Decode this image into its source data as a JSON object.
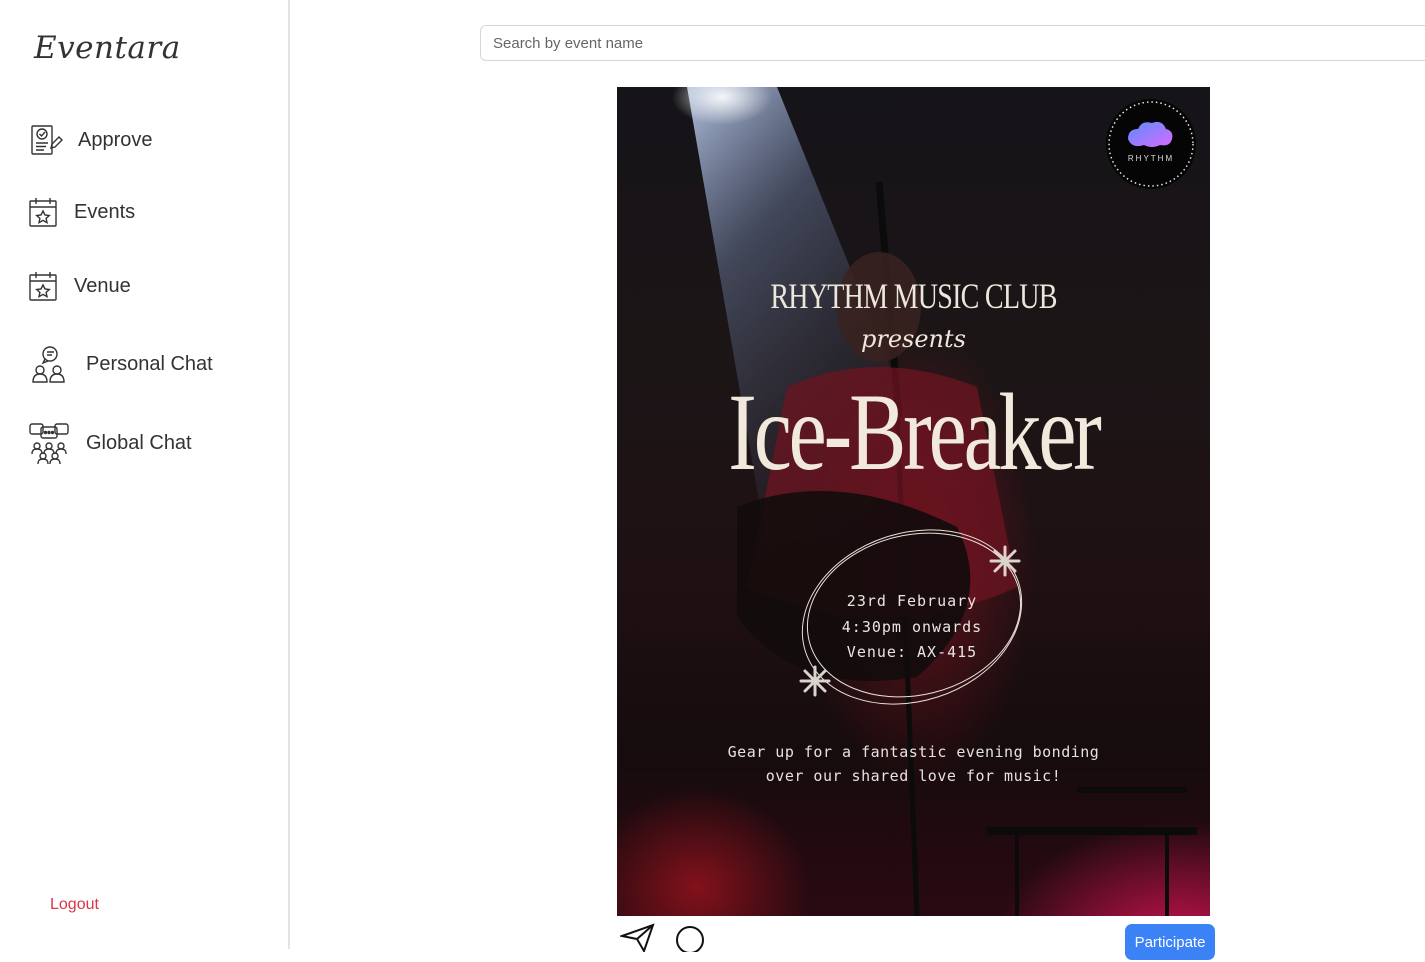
{
  "brand": "Eventara",
  "sidebar": {
    "items": [
      {
        "label": "Approve",
        "icon": "approve-document-icon"
      },
      {
        "label": "Events",
        "icon": "calendar-star-icon"
      },
      {
        "label": "Venue",
        "icon": "calendar-star-icon"
      },
      {
        "label": "Personal Chat",
        "icon": "personal-chat-icon"
      },
      {
        "label": "Global Chat",
        "icon": "global-chat-icon"
      }
    ],
    "logout": "Logout"
  },
  "search": {
    "placeholder": "Search by event name"
  },
  "event": {
    "poster": {
      "logo_text": "RHYTHM",
      "club": "RHYTHM MUSIC CLUB",
      "presents": "presents",
      "title": "Ice-Breaker",
      "date": "23rd February",
      "time": "4:30pm onwards",
      "venue": "Venue: AX-415",
      "description_line1": "Gear up for a fantastic evening bonding",
      "description_line2": "over our shared love for music!"
    },
    "actions": {
      "share_icon": "send-icon",
      "comment_icon": "comment-icon",
      "participate_label": "Participate"
    }
  },
  "colors": {
    "logout": "#dc3545",
    "participate": "#3b82f6",
    "sidebar_border": "#e3e3e3"
  }
}
